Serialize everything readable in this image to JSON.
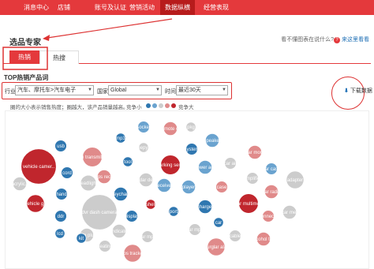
{
  "nav": {
    "items": [
      {
        "label": "消息中心",
        "active": false
      },
      {
        "label": "店铺",
        "active": false
      },
      {
        "label": "账号及认证",
        "active": false
      },
      {
        "label": "营销活动",
        "active": false
      },
      {
        "label": "数据纵横",
        "active": true
      },
      {
        "label": "经营表现",
        "active": false
      }
    ]
  },
  "page": {
    "title": "选品专家",
    "help_prefix": "看不懂图表在说什么?",
    "help_link": "来这里看看"
  },
  "tabs": [
    {
      "label": "热销",
      "active": true
    },
    {
      "label": "热搜",
      "active": false
    }
  ],
  "section": {
    "title": "TOP热销产品词"
  },
  "filters": {
    "industry_label": "行业",
    "industry_value": "汽车、摩托车>汽车电子",
    "country_label": "国家",
    "country_value": "Global",
    "time_label": "时间",
    "time_value": "最近30天"
  },
  "download": {
    "label": "下载数据"
  },
  "chart_note": "圈的大小表示销售热度；圈越大，该产品销量越高。",
  "legend": {
    "small_label": "竞争小",
    "big_label": "竞争大"
  },
  "colors": {
    "brand_red": "#e4393c",
    "competition_scale": [
      "#2f77b0",
      "#6aa3cf",
      "#cccccc",
      "#e08a8a",
      "#c0262d"
    ]
  },
  "chart_data": {
    "type": "bubble",
    "size_meaning": "sales heat",
    "color_meaning": "competition level (1 low - 5 high)",
    "bubbles": [
      {
        "label": "vehicle camer..",
        "size": 36,
        "competition": 5
      },
      {
        "label": "vehicle g..",
        "size": 18,
        "competition": 5
      },
      {
        "label": "usb",
        "size": 12,
        "competition": 1
      },
      {
        "label": "fm transmitte",
        "size": 20,
        "competition": 4
      },
      {
        "label": "mp3",
        "size": 10,
        "competition": 1
      },
      {
        "label": "socket",
        "size": 12,
        "competition": 2
      },
      {
        "label": "remote c..",
        "size": 14,
        "competition": 4
      },
      {
        "label": "pkg",
        "size": 10,
        "competition": 3
      },
      {
        "label": "sleepy r..",
        "size": 10,
        "competition": 3
      },
      {
        "label": "speaker",
        "size": 14,
        "competition": 2
      },
      {
        "label": "system",
        "size": 12,
        "competition": 1
      },
      {
        "label": "parking sen..",
        "size": 20,
        "competition": 5
      },
      {
        "label": "tool",
        "size": 10,
        "competition": 1
      },
      {
        "label": "cord",
        "size": 12,
        "competition": 1
      },
      {
        "label": "gps rece",
        "size": 14,
        "competition": 4
      },
      {
        "label": "radar det..",
        "size": 14,
        "competition": 3
      },
      {
        "label": "power ad..",
        "size": 14,
        "competition": 2
      },
      {
        "label": "car mont",
        "size": 14,
        "competition": 4
      },
      {
        "label": "car air",
        "size": 12,
        "competition": 3
      },
      {
        "label": "car cass",
        "size": 12,
        "competition": 2
      },
      {
        "label": "hand",
        "size": 12,
        "competition": 1
      },
      {
        "label": "headligh..",
        "size": 16,
        "competition": 3
      },
      {
        "label": "keychain",
        "size": 14,
        "competition": 1
      },
      {
        "label": "receiver",
        "size": 14,
        "competition": 2
      },
      {
        "label": "player",
        "size": 14,
        "competition": 2
      },
      {
        "label": "case",
        "size": 12,
        "competition": 4
      },
      {
        "label": "car radio",
        "size": 14,
        "competition": 4
      },
      {
        "label": "adapter",
        "size": 18,
        "competition": 3
      },
      {
        "label": "acrylic..",
        "size": 14,
        "competition": 3
      },
      {
        "label": "amplifier",
        "size": 12,
        "competition": 3
      },
      {
        "label": "dvr dash camera",
        "size": 36,
        "competition": 3
      },
      {
        "label": "shell",
        "size": 10,
        "competition": 5
      },
      {
        "label": "port",
        "size": 10,
        "competition": 1
      },
      {
        "label": "charger",
        "size": 14,
        "competition": 1
      },
      {
        "label": "car multimed",
        "size": 20,
        "competition": 5
      },
      {
        "label": "connecto",
        "size": 12,
        "competition": 4
      },
      {
        "label": "car mer",
        "size": 14,
        "competition": 3
      },
      {
        "label": "amp plug",
        "size": 14,
        "competition": 3
      },
      {
        "label": "display",
        "size": 12,
        "competition": 1
      },
      {
        "label": "ddr",
        "size": 12,
        "competition": 1
      },
      {
        "label": "lcd",
        "size": 10,
        "competition": 1
      },
      {
        "label": "kit",
        "size": 10,
        "competition": 1
      },
      {
        "label": "indicato",
        "size": 14,
        "competition": 3
      },
      {
        "label": "heating",
        "size": 12,
        "competition": 3
      },
      {
        "label": "car mp3",
        "size": 12,
        "competition": 3
      },
      {
        "label": "car mp..",
        "size": 12,
        "competition": 3
      },
      {
        "label": "car",
        "size": 10,
        "competition": 1
      },
      {
        "label": "cable",
        "size": 12,
        "competition": 3
      },
      {
        "label": "alcohol te..",
        "size": 14,
        "competition": 4
      },
      {
        "label": "gps tracker",
        "size": 18,
        "competition": 4
      },
      {
        "label": "burglar alar",
        "size": 18,
        "competition": 4
      }
    ]
  }
}
